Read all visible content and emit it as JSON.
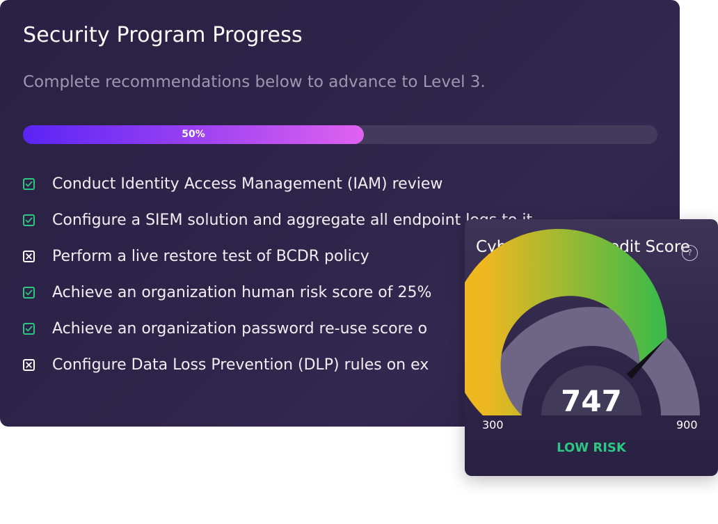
{
  "program": {
    "title": "Security Program Progress",
    "subtitle": "Complete recommendations below to advance to Level 3.",
    "progress_percent": 50,
    "progress_label": "50%",
    "colors": {
      "done": "#2dc781",
      "todo": "#ffffff",
      "bar_start": "#5a24f5",
      "bar_end": "#e062f0"
    },
    "tasks": [
      {
        "label": "Conduct Identity Access Management (IAM) review",
        "status": "done",
        "icon": "checkbox-checked-icon"
      },
      {
        "label": "Configure a SIEM solution and aggregate all endpoint logs to  it",
        "status": "done",
        "icon": "checkbox-checked-icon"
      },
      {
        "label": "Perform a live restore test of BCDR policy",
        "status": "todo",
        "icon": "checkbox-x-icon"
      },
      {
        "label": "Achieve an organization human risk score of 25%",
        "status": "done",
        "icon": "checkbox-checked-icon"
      },
      {
        "label": "Achieve an organization password re-use score o",
        "status": "done",
        "icon": "checkbox-checked-icon"
      },
      {
        "label": "Configure Data Loss Prevention (DLP) rules on ex",
        "status": "todo",
        "icon": "checkbox-x-icon"
      }
    ]
  },
  "score_card": {
    "title": "Cybersecurity Credit Score",
    "help_icon": "?",
    "score": 747,
    "score_label": "747",
    "min": 300,
    "min_label": "300",
    "max": 900,
    "max_label": "900",
    "risk_label": "LOW RISK",
    "colors": {
      "gauge_start": "#f0b820",
      "gauge_end": "#3fba48",
      "gauge_track": "#6e6684",
      "risk": "#2dc781"
    }
  }
}
